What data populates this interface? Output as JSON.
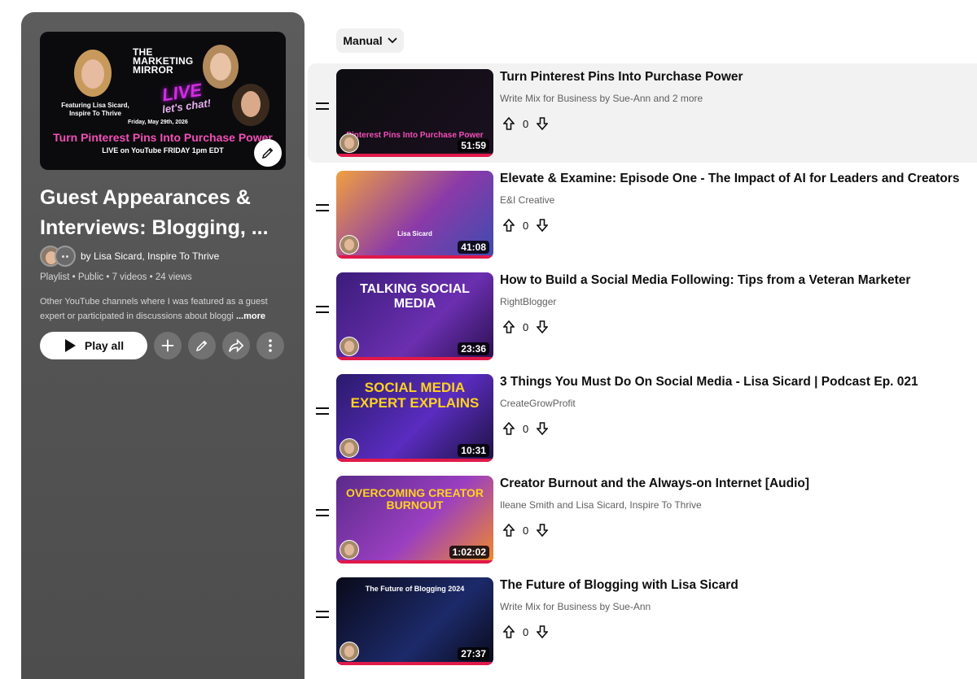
{
  "playlist": {
    "title": "Guest Appearances & Interviews: Blogging, ...",
    "owner": "by Lisa Sicard, Inspire To Thrive",
    "meta": "Playlist • Public • 7 videos • 24 views",
    "description": "Other YouTube channels where I was featured as a guest expert or participated in discussions about bloggi",
    "more_label": "...more",
    "play_all_label": "Play all",
    "hero": {
      "brand_line": "THE MARKETING MIRROR",
      "live": "LIVE",
      "chat": "let's chat!",
      "featuring": "Featuring Lisa Sicard, Inspire To Thrive",
      "date": "Friday, May 29th, 2026",
      "headline": "Turn Pinterest Pins Into Purchase Power",
      "subline": "LIVE on YouTube FRIDAY 1pm EDT"
    }
  },
  "sort": {
    "label": "Manual"
  },
  "videos": [
    {
      "title": "Turn Pinterest Pins Into Purchase Power",
      "channel": "Write Mix for Business by Sue-Ann  and 2 more",
      "votes": "0",
      "duration": "51:59",
      "thumb_text": "Pinterest Pins Into Purchase Power",
      "active": true
    },
    {
      "title": "Elevate & Examine: Episode One - The Impact of AI for Leaders and Creators",
      "channel": "E&I Creative",
      "votes": "0",
      "duration": "41:08",
      "thumb_text": "Lisa Sicard"
    },
    {
      "title": "How to Build a Social Media Following: Tips from a Veteran Marketer",
      "channel": "RightBlogger",
      "votes": "0",
      "duration": "23:36",
      "thumb_text": "TALKING SOCIAL MEDIA"
    },
    {
      "title": "3 Things You Must Do On Social Media - Lisa Sicard | Podcast Ep. 021",
      "channel": "CreateGrowProfit",
      "votes": "0",
      "duration": "10:31",
      "thumb_text": "SOCIAL MEDIA EXPERT EXPLAINS"
    },
    {
      "title": "Creator Burnout and the Always-on Internet [Audio]",
      "channel": "Ileane Smith and Lisa Sicard, Inspire To Thrive",
      "votes": "0",
      "duration": "1:02:02",
      "thumb_text": "OVERCOMING CREATOR BURNOUT"
    },
    {
      "title": "The Future of Blogging with Lisa Sicard",
      "channel": "Write Mix for Business by Sue-Ann",
      "votes": "0",
      "duration": "27:37",
      "thumb_text": "The Future of Blogging 2024"
    }
  ],
  "colors": {
    "accent_red": "#e0194a",
    "panel": "#565656"
  }
}
